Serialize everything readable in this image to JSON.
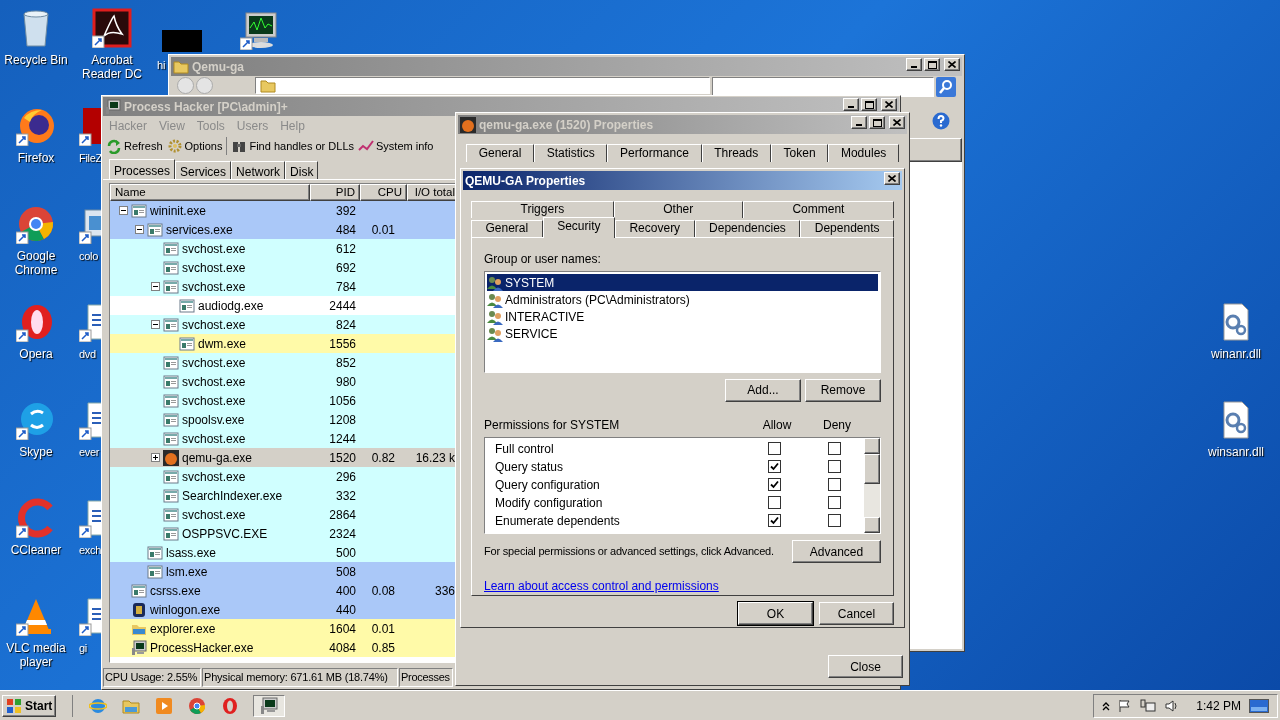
{
  "desktop": {
    "icons": [
      {
        "label": "Recycle Bin",
        "kind": "recycle"
      },
      {
        "label": "Firefox",
        "kind": "firefox"
      },
      {
        "label": "Google Chrome",
        "kind": "chrome"
      },
      {
        "label": "Opera",
        "kind": "opera"
      },
      {
        "label": "Skype",
        "kind": "skype"
      },
      {
        "label": "CCleaner",
        "kind": "ccleaner"
      },
      {
        "label": "VLC media player",
        "kind": "vlc"
      }
    ],
    "icons_column_2": [
      {
        "label": "Acrobat Reader DC",
        "kind": "acrobat"
      },
      {
        "label": "FileZ",
        "kind": "filezilla"
      },
      {
        "label": "colo",
        "kind": "generic"
      },
      {
        "label": "dvd",
        "kind": "doc"
      },
      {
        "label": "ever",
        "kind": "doc"
      },
      {
        "label": "exch",
        "kind": "doc"
      },
      {
        "label": "gi",
        "kind": "doc"
      }
    ],
    "icons_top": [
      {
        "label": "hi",
        "kind": "black"
      },
      {
        "kind": "monitor"
      }
    ],
    "icons_right": [
      {
        "label": "winanr.dll",
        "kind": "dll"
      },
      {
        "label": "winsanr.dll",
        "kind": "dll"
      }
    ]
  },
  "explorer_window": {
    "title": "Qemu-ga"
  },
  "process_hacker": {
    "title": "Process Hacker [PC\\admin]+",
    "menu": [
      "Hacker",
      "View",
      "Tools",
      "Users",
      "Help"
    ],
    "toolbar": [
      {
        "label": "Refresh",
        "kind": "refresh"
      },
      {
        "label": "Options",
        "kind": "options"
      },
      {
        "label": "Find handles or DLLs",
        "kind": "find"
      },
      {
        "label": "System info",
        "kind": "sysinfo"
      }
    ],
    "tabs": [
      {
        "label": "Processes",
        "selected": true
      },
      {
        "label": "Services",
        "selected": false
      },
      {
        "label": "Network",
        "selected": false
      },
      {
        "label": "Disk",
        "selected": false
      }
    ],
    "columns": [
      "Name",
      "PID",
      "CPU",
      "I/O total"
    ],
    "processes": [
      {
        "name": "wininit.exe",
        "pid": "392",
        "kind": "window",
        "color": "#aac8f8",
        "selected": false,
        "expanded": true,
        "children": [
          {
            "name": "services.exe",
            "pid": "484",
            "cpu": "0.01",
            "kind": "window",
            "color": "#aac8f8",
            "selected": false,
            "expanded": true,
            "children": [
              {
                "name": "svchost.exe",
                "pid": "612",
                "kind": "window",
                "color": "#d0ffff",
                "selected": false
              },
              {
                "name": "svchost.exe",
                "pid": "692",
                "kind": "window",
                "color": "#d0ffff",
                "selected": false
              },
              {
                "name": "svchost.exe",
                "pid": "784",
                "kind": "window",
                "color": "#d0ffff",
                "selected": false,
                "expanded": true,
                "children": [
                  {
                    "name": "audiodg.exe",
                    "pid": "2444",
                    "kind": "window",
                    "color": "#ffffff",
                    "selected": false
                  }
                ]
              },
              {
                "name": "svchost.exe",
                "pid": "824",
                "kind": "window",
                "color": "#d0ffff",
                "selected": false,
                "expanded": true,
                "children": [
                  {
                    "name": "dwm.exe",
                    "pid": "1556",
                    "kind": "window",
                    "color": "#fffaa8",
                    "selected": false
                  }
                ]
              },
              {
                "name": "svchost.exe",
                "pid": "852",
                "kind": "window",
                "color": "#d0ffff",
                "selected": false
              },
              {
                "name": "svchost.exe",
                "pid": "980",
                "kind": "window",
                "color": "#d0ffff",
                "selected": false
              },
              {
                "name": "svchost.exe",
                "pid": "1056",
                "kind": "window",
                "color": "#d0ffff",
                "selected": false
              },
              {
                "name": "spoolsv.exe",
                "pid": "1208",
                "kind": "window",
                "color": "#d0ffff",
                "selected": false
              },
              {
                "name": "svchost.exe",
                "pid": "1244",
                "kind": "window",
                "color": "#d0ffff",
                "selected": false
              },
              {
                "name": "qemu-ga.exe",
                "pid": "1520",
                "cpu": "0.82",
                "io": "16.23 k",
                "kind": "qemu",
                "selected": true,
                "expanded": false
              },
              {
                "name": "svchost.exe",
                "pid": "296",
                "kind": "window",
                "color": "#d0ffff",
                "selected": false
              },
              {
                "name": "SearchIndexer.exe",
                "pid": "332",
                "kind": "window",
                "color": "#d0ffff",
                "selected": false
              },
              {
                "name": "svchost.exe",
                "pid": "2864",
                "kind": "window",
                "color": "#d0ffff",
                "selected": false
              },
              {
                "name": "OSPPSVC.EXE",
                "pid": "2324",
                "kind": "window",
                "color": "#d0ffff",
                "selected": false
              }
            ]
          },
          {
            "name": "lsass.exe",
            "pid": "500",
            "kind": "window",
            "color": "#d0ffff",
            "selected": false
          },
          {
            "name": "lsm.exe",
            "pid": "508",
            "kind": "window",
            "color": "#aac8f8",
            "selected": false
          }
        ]
      },
      {
        "name": "csrss.exe",
        "pid": "400",
        "cpu": "0.08",
        "io": "336",
        "kind": "window",
        "color": "#aac8f8",
        "selected": false
      },
      {
        "name": "winlogon.exe",
        "pid": "440",
        "kind": "winlogon",
        "color": "#aac8f8",
        "selected": false
      },
      {
        "name": "explorer.exe",
        "pid": "1604",
        "cpu": "0.01",
        "kind": "explorer",
        "color": "#fffaa8",
        "selected": false
      },
      {
        "name": "ProcessHacker.exe",
        "pid": "4084",
        "cpu": "0.85",
        "kind": "monitor",
        "color": "#fffaa8",
        "selected": false
      }
    ],
    "status_bar": [
      "CPU Usage: 2.55%",
      "Physical memory: 671.61 MB (18.74%)",
      "Processes"
    ]
  },
  "process_properties": {
    "title": "qemu-ga.exe (1520) Properties",
    "tabs": [
      {
        "label": "General",
        "selected": false
      },
      {
        "label": "Statistics",
        "selected": false
      },
      {
        "label": "Performance",
        "selected": false
      },
      {
        "label": "Threads",
        "selected": false
      },
      {
        "label": "Token",
        "selected": false
      },
      {
        "label": "Modules",
        "selected": false
      }
    ],
    "close_button": "Close"
  },
  "service_properties": {
    "title": "QEMU-GA Properties",
    "tabs_back": [
      {
        "label": "Triggers",
        "selected": false
      },
      {
        "label": "Other",
        "selected": false
      },
      {
        "label": "Comment",
        "selected": false
      }
    ],
    "tabs_front": [
      {
        "label": "General",
        "selected": false
      },
      {
        "label": "Security",
        "selected": true
      },
      {
        "label": "Recovery",
        "selected": false
      },
      {
        "label": "Dependencies",
        "selected": false
      },
      {
        "label": "Dependents",
        "selected": false
      }
    ],
    "group_label": "Group or user names:",
    "users": [
      {
        "name": "SYSTEM",
        "selected": true
      },
      {
        "name": "Administrators (PC\\Administrators)",
        "selected": false
      },
      {
        "name": "INTERACTIVE",
        "selected": false
      },
      {
        "name": "SERVICE",
        "selected": false
      }
    ],
    "add_button": "Add...",
    "remove_button": "Remove",
    "permissions_label": "Permissions for SYSTEM",
    "allow_header": "Allow",
    "deny_header": "Deny",
    "permissions": [
      {
        "name": "Full control",
        "allow": false,
        "deny": false
      },
      {
        "name": "Query status",
        "allow": true,
        "deny": false
      },
      {
        "name": "Query configuration",
        "allow": true,
        "deny": false
      },
      {
        "name": "Modify configuration",
        "allow": false,
        "deny": false
      },
      {
        "name": "Enumerate dependents",
        "allow": true,
        "deny": false
      }
    ],
    "advanced_hint": "For special permissions or advanced settings, click Advanced.",
    "advanced_button": "Advanced",
    "link": "Learn about access control and permissions",
    "ok_button": "OK",
    "cancel_button": "Cancel"
  },
  "taskbar": {
    "start": "Start",
    "quick_launch": [
      {
        "kind": "ie"
      },
      {
        "kind": "folder"
      },
      {
        "kind": "media"
      },
      {
        "kind": "chrome"
      },
      {
        "kind": "opera"
      }
    ],
    "tasks": [
      {
        "kind": "monitor",
        "selected": true
      }
    ],
    "clock": "1:42 PM"
  }
}
